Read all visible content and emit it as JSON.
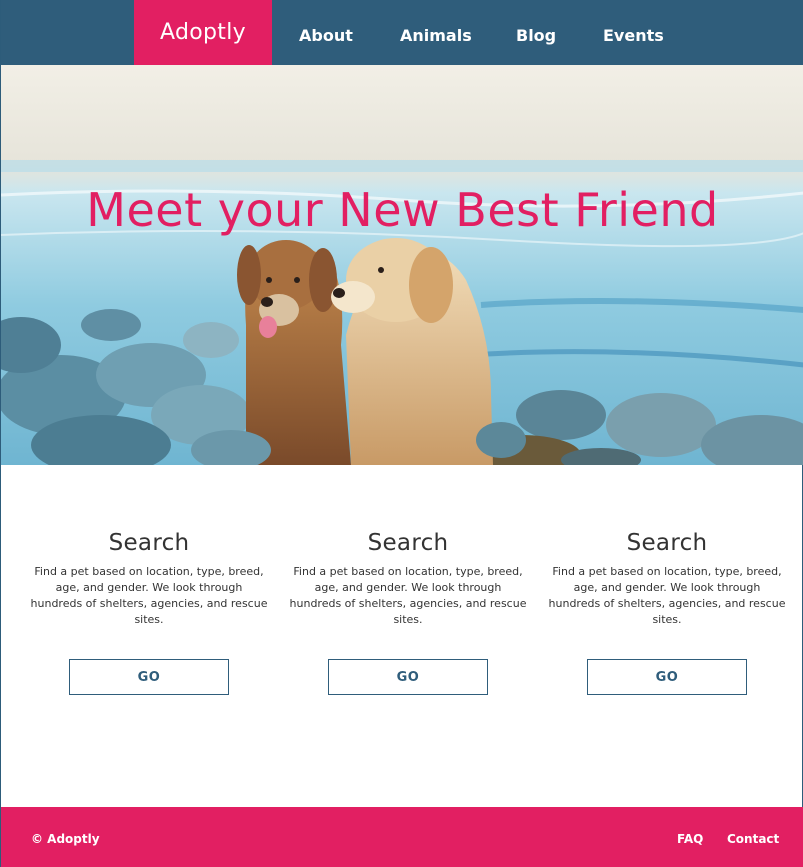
{
  "brand": {
    "name": "Adoptly"
  },
  "nav": {
    "items": [
      "About",
      "Animals",
      "Blog",
      "Events"
    ]
  },
  "hero": {
    "headline": "Meet your New Best Friend"
  },
  "features": [
    {
      "title": "Search",
      "body": "Find a pet based on location, type, breed, age, and gender. We look through hundreds of shelters, agencies, and rescue sites.",
      "button": "GO"
    },
    {
      "title": "Search",
      "body": "Find a pet based on location, type, breed, age, and gender. We look through hundreds of shelters, agencies, and rescue sites.",
      "button": "GO"
    },
    {
      "title": "Search",
      "body": "Find a pet based on location, type, breed, age, and gender. We look through hundreds of shelters, agencies, and rescue sites.",
      "button": "GO"
    }
  ],
  "footer": {
    "copyright": "© Adoptly",
    "links": [
      "FAQ",
      "Contact"
    ]
  },
  "colors": {
    "primary": "#e21f62",
    "nav": "#2f5d7b"
  }
}
